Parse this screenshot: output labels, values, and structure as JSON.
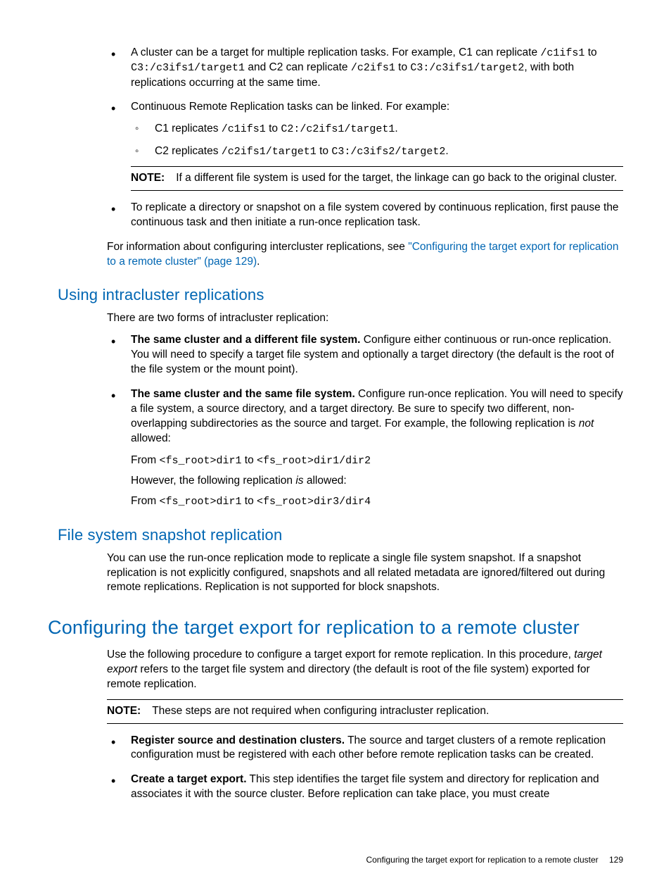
{
  "bullets_top": [
    {
      "pre": "A cluster can be a target for multiple replication tasks. For example, C1 can replicate ",
      "c1": "/c1ifs1",
      "mid1": " to ",
      "c2": "C3:/c3ifs1/target1",
      "mid2": " and C2 can replicate ",
      "c3": "/c2ifs1",
      "mid3": " to ",
      "c4": "C3:/c3ifs1/target2",
      "post": ", with both replications occurring at the same time."
    }
  ],
  "bullet_linked_intro": "Continuous Remote Replication tasks can be linked. For example:",
  "sub_bullets": [
    {
      "pre": "C1 replicates ",
      "c1": "/c1ifs1",
      "mid": " to ",
      "c2": "C2:/c2ifs1/target1",
      "post": "."
    },
    {
      "pre": "C2 replicates ",
      "c1": "/c2ifs1/target1",
      "mid": " to ",
      "c2": "C3:/c3ifs2/target2",
      "post": "."
    }
  ],
  "note1": {
    "label": "NOTE:",
    "text": "If a different file system is used for the target, the linkage can go back to the original cluster."
  },
  "bullet_replicate_dir": "To replicate a directory or snapshot on a file system covered by continuous replication, first pause the continuous task and then initiate a run-once replication task.",
  "info_line": {
    "pre": "For information about configuring intercluster replications, see ",
    "link": "\"Configuring the target export for replication to a remote cluster\" (page 129)",
    "post": "."
  },
  "h_intra": "Using intracluster replications",
  "intra_intro": "There are two forms of intracluster replication:",
  "intra_b1": {
    "bold": "The same cluster and a different file system.",
    "text": " Configure either continuous or run-once replication. You will need to specify a target file system and optionally a target directory (the default is the root of the file system or the mount point)."
  },
  "intra_b2": {
    "bold": "The same cluster and the same file system.",
    "text1": " Configure run-once replication. You will need to specify a file system, a source directory, and a target directory. Be sure to specify two different, non-overlapping subdirectories as the source and target. For example, the following replication is ",
    "ital": "not",
    "text2": " allowed:",
    "line1_pre": "From ",
    "line1_c1": "<fs_root>dir1",
    "line1_mid": " to ",
    "line1_c2": "<fs_root>dir1/dir2",
    "however_pre": "However, the following replication ",
    "however_ital": "is",
    "however_post": " allowed:",
    "line2_pre": "From ",
    "line2_c1": "<fs_root>dir1",
    "line2_mid": " to ",
    "line2_c2": "<fs_root>dir3/dir4"
  },
  "h_fss": "File system snapshot replication",
  "fss_text": "You can use the run-once replication mode to replicate a single file system snapshot. If a snapshot replication is not explicitly configured, snapshots and all related metadata are ignored/filtered out during remote replications. Replication is not supported for block snapshots.",
  "h_main": "Configuring the target export for replication to a remote cluster",
  "cte_intro": {
    "pre": "Use the following procedure to configure a target export for remote replication. In this procedure, ",
    "ital": "target export",
    "post": " refers to the target file system and directory (the default is root of the file system) exported for remote replication."
  },
  "note2": {
    "label": "NOTE:",
    "text": "These steps are not required when configuring intracluster replication."
  },
  "cte_b1": {
    "bold": "Register source and destination clusters.",
    "text": " The source and target clusters of a remote replication configuration must be registered with each other before remote replication tasks can be created."
  },
  "cte_b2": {
    "bold": "Create a target export.",
    "text": " This step identifies the target file system and directory for replication and associates it with the source cluster. Before replication can take place, you must create"
  },
  "footer": {
    "title": "Configuring the target export for replication to a remote cluster",
    "page": "129"
  }
}
